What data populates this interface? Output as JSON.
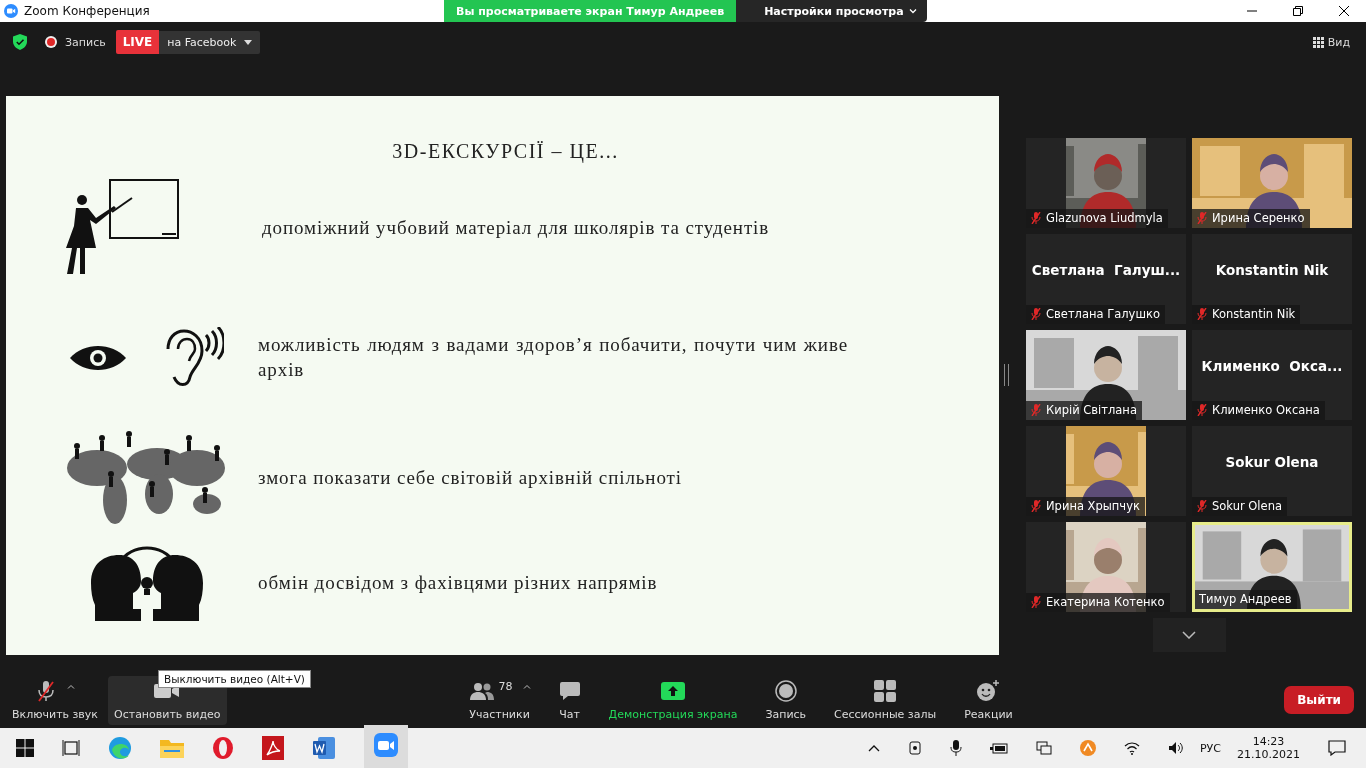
{
  "window": {
    "title": "Zoom Конференция"
  },
  "share_banner": {
    "text": "Вы просматриваете экран Тимур Андреев",
    "view_options": "Настройки просмотра"
  },
  "top_bar": {
    "record_label": "Запись",
    "live_badge": "LIVE",
    "live_target": "на Facebook",
    "view_button": "Вид"
  },
  "slide": {
    "title": "3D-ЕКСКУРСІЇ – ЦЕ...",
    "items": [
      {
        "kind": "teacher",
        "text": "допоміжний учбовий матеріал для школярів та студентів"
      },
      {
        "kind": "senses",
        "text": "можливість людям з вадами здоров’я побачити, почути чим живе архів"
      },
      {
        "kind": "world",
        "text": "змога показати себе світовій архівній спільноті"
      },
      {
        "kind": "heads",
        "text": "обмін досвідом з фахівцями різних напрямів"
      }
    ]
  },
  "participants": [
    {
      "name": "Glazunova Liudmyla",
      "kind": "video_narrow",
      "muted": true,
      "speaking": false
    },
    {
      "name": "Ирина Серенко",
      "kind": "video",
      "muted": true,
      "speaking": false
    },
    {
      "name": "Светлана Галушко",
      "kind": "name",
      "big_name": "Светлана  Галуш...",
      "muted": true,
      "speaking": false
    },
    {
      "name": "Konstantin Nik",
      "kind": "name",
      "big_name": "Konstantin Nik",
      "muted": true,
      "speaking": false
    },
    {
      "name": "Кирій Світлана",
      "kind": "video",
      "muted": true,
      "speaking": false
    },
    {
      "name": "Клименко Оксана",
      "kind": "name",
      "big_name": "Клименко  Окса...",
      "muted": true,
      "speaking": false
    },
    {
      "name": "Ирина Хрыпчук",
      "kind": "video_narrow",
      "muted": true,
      "speaking": false
    },
    {
      "name": "Sokur Olena",
      "kind": "name",
      "big_name": "Sokur Olena",
      "muted": true,
      "speaking": false
    },
    {
      "name": "Екатерина Котенко",
      "kind": "video_narrow",
      "muted": true,
      "speaking": false
    },
    {
      "name": "Тимур Андреев",
      "kind": "video",
      "muted": false,
      "speaking": true
    }
  ],
  "toolbar": {
    "left": [
      {
        "kind": "mic",
        "label": "Включить звук",
        "highlighted": false
      },
      {
        "kind": "video",
        "label": "Остановить видео",
        "highlighted": true
      }
    ],
    "center": [
      {
        "kind": "participants",
        "label": "Участники",
        "highlighted": false
      },
      {
        "kind": "chat",
        "label": "Чат",
        "highlighted": false
      },
      {
        "kind": "share",
        "label": "Демонстрация экрана",
        "highlighted": false
      },
      {
        "kind": "record",
        "label": "Запись",
        "highlighted": false
      },
      {
        "kind": "breakout",
        "label": "Сессионные залы",
        "highlighted": false
      },
      {
        "kind": "reactions",
        "label": "Реакции",
        "highlighted": false
      }
    ],
    "participants_count": "78",
    "leave_button": "Выйти"
  },
  "tooltip": "Выключить видео (Alt+V)",
  "taskbar": {
    "language": "РУС",
    "time": "14:23",
    "date": "21.10.2021"
  }
}
